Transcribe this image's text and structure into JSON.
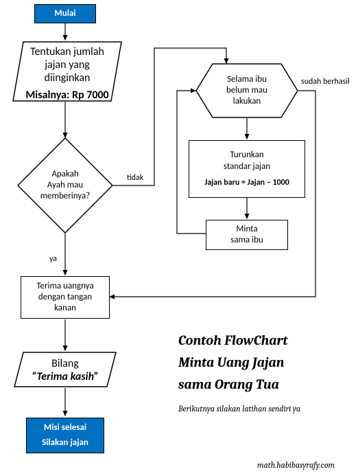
{
  "start": {
    "label": "Mulai"
  },
  "input": {
    "line1": "Tentukan jumlah",
    "line2": "jajan yang",
    "line3": "diinginkan",
    "example_label": "Misalnya:",
    "example_value": "Rp 7000"
  },
  "decision": {
    "line1": "Apakah",
    "line2": "Ayah mau",
    "line3": "memberinya?",
    "yes": "ya",
    "no": "tidak"
  },
  "loop": {
    "cond1": "Selama ibu",
    "cond2": "belum mau",
    "cond3": "lakukan",
    "exit": "sudah berhasil",
    "step1_l1": "Turunkan",
    "step1_l2": "standar jajan",
    "step1_formula": "Jajan baru = Jajan  – 1000",
    "step2_l1": "Minta",
    "step2_l2": "sama ibu"
  },
  "accept": {
    "l1": "Terima uangnya",
    "l2": "dengan tangan",
    "l3": "kanan"
  },
  "output": {
    "l1": "Bilang",
    "l2": "“Terima kasih”"
  },
  "end": {
    "l1": "Misi selesai",
    "l2": "Silakan jajan"
  },
  "title": {
    "l1": "Contoh FlowChart",
    "l2": "Minta Uang Jajan",
    "l3": "sama Orang Tua"
  },
  "subtitle": "Berikutnya silakan latihan sendiri ya",
  "footer": "math.habibasyrafy.com"
}
